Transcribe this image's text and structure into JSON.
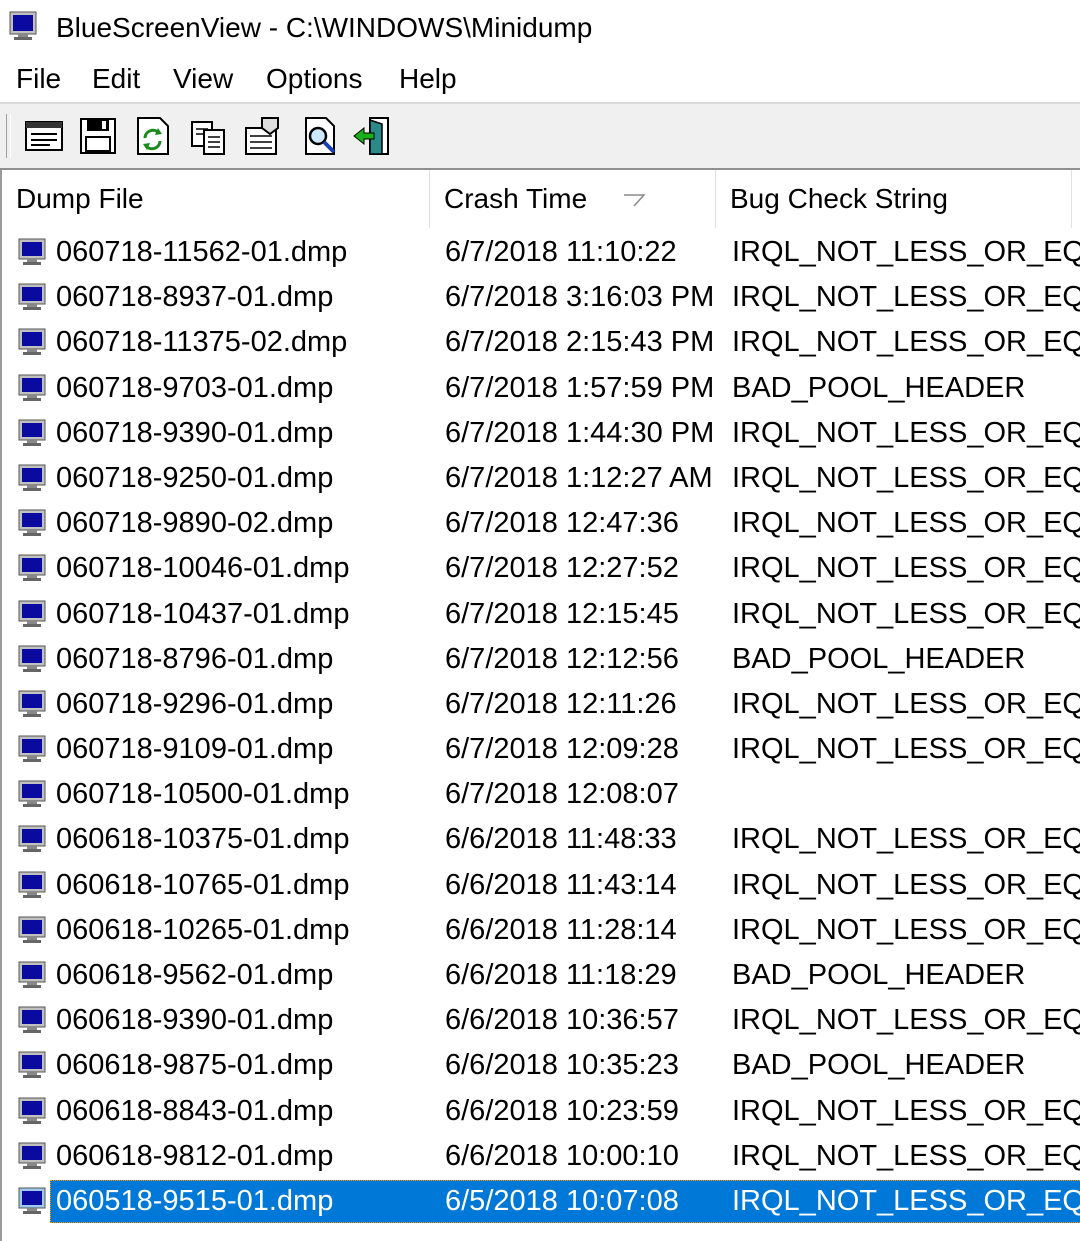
{
  "window": {
    "title": "BlueScreenView  -  C:\\WINDOWS\\Minidump",
    "icon": "monitor-icon"
  },
  "menu": [
    "File",
    "Edit",
    "View",
    "Options",
    "Help"
  ],
  "toolbar": {
    "buttons": [
      {
        "name": "html-report-icon"
      },
      {
        "name": "save-icon"
      },
      {
        "name": "refresh-icon"
      },
      {
        "name": "copy-icon"
      },
      {
        "name": "properties-icon"
      },
      {
        "name": "find-icon"
      },
      {
        "name": "exit-icon"
      }
    ]
  },
  "columns": {
    "dump_file": "Dump File",
    "crash_time": "Crash Time",
    "bug_check": "Bug Check String",
    "sorted_column": "crash_time"
  },
  "colors": {
    "selection": "#0078d7",
    "monitor_screen": "#0a0aa0"
  },
  "rows": [
    {
      "file": "060718-11562-01.dmp",
      "time": "6/7/2018 11:10:22",
      "bug": "IRQL_NOT_LESS_OR_EQ"
    },
    {
      "file": "060718-8937-01.dmp",
      "time": "6/7/2018 3:16:03 PM",
      "bug": "IRQL_NOT_LESS_OR_EQ"
    },
    {
      "file": "060718-11375-02.dmp",
      "time": "6/7/2018 2:15:43 PM",
      "bug": "IRQL_NOT_LESS_OR_EQ"
    },
    {
      "file": "060718-9703-01.dmp",
      "time": "6/7/2018 1:57:59 PM",
      "bug": "BAD_POOL_HEADER"
    },
    {
      "file": "060718-9390-01.dmp",
      "time": "6/7/2018 1:44:30 PM",
      "bug": "IRQL_NOT_LESS_OR_EQ"
    },
    {
      "file": "060718-9250-01.dmp",
      "time": "6/7/2018 1:12:27 AM",
      "bug": "IRQL_NOT_LESS_OR_EQ"
    },
    {
      "file": "060718-9890-02.dmp",
      "time": "6/7/2018 12:47:36",
      "bug": "IRQL_NOT_LESS_OR_EQ"
    },
    {
      "file": "060718-10046-01.dmp",
      "time": "6/7/2018 12:27:52",
      "bug": "IRQL_NOT_LESS_OR_EQ"
    },
    {
      "file": "060718-10437-01.dmp",
      "time": "6/7/2018 12:15:45",
      "bug": "IRQL_NOT_LESS_OR_EQ"
    },
    {
      "file": "060718-8796-01.dmp",
      "time": "6/7/2018 12:12:56",
      "bug": "BAD_POOL_HEADER"
    },
    {
      "file": "060718-9296-01.dmp",
      "time": "6/7/2018 12:11:26",
      "bug": "IRQL_NOT_LESS_OR_EQ"
    },
    {
      "file": "060718-9109-01.dmp",
      "time": "6/7/2018 12:09:28",
      "bug": "IRQL_NOT_LESS_OR_EQ"
    },
    {
      "file": "060718-10500-01.dmp",
      "time": "6/7/2018 12:08:07",
      "bug": ""
    },
    {
      "file": "060618-10375-01.dmp",
      "time": "6/6/2018 11:48:33",
      "bug": "IRQL_NOT_LESS_OR_EQ"
    },
    {
      "file": "060618-10765-01.dmp",
      "time": "6/6/2018 11:43:14",
      "bug": "IRQL_NOT_LESS_OR_EQ"
    },
    {
      "file": "060618-10265-01.dmp",
      "time": "6/6/2018 11:28:14",
      "bug": "IRQL_NOT_LESS_OR_EQ"
    },
    {
      "file": "060618-9562-01.dmp",
      "time": "6/6/2018 11:18:29",
      "bug": "BAD_POOL_HEADER"
    },
    {
      "file": "060618-9390-01.dmp",
      "time": "6/6/2018 10:36:57",
      "bug": "IRQL_NOT_LESS_OR_EQ"
    },
    {
      "file": "060618-9875-01.dmp",
      "time": "6/6/2018 10:35:23",
      "bug": "BAD_POOL_HEADER"
    },
    {
      "file": "060618-8843-01.dmp",
      "time": "6/6/2018 10:23:59",
      "bug": "IRQL_NOT_LESS_OR_EQ"
    },
    {
      "file": "060618-9812-01.dmp",
      "time": "6/6/2018 10:00:10",
      "bug": "IRQL_NOT_LESS_OR_EQ"
    },
    {
      "file": "060518-9515-01.dmp",
      "time": "6/5/2018 10:07:08",
      "bug": "IRQL_NOT_LESS_OR_EQ",
      "selected": true
    }
  ]
}
